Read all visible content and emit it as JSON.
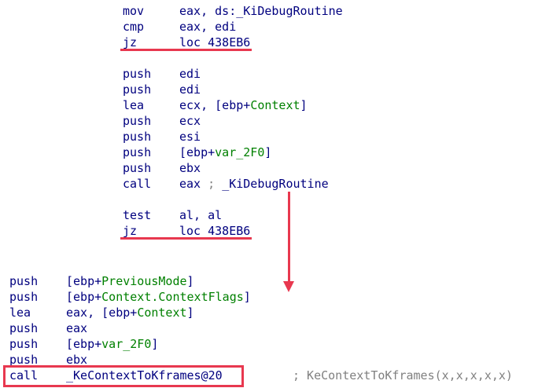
{
  "block1": [
    {
      "mnemonic": "mov",
      "op_parts": [
        {
          "t": "eax, ds:",
          "c": "dl"
        },
        {
          "t": "_KiDebugRoutine",
          "c": "dl"
        }
      ]
    },
    {
      "mnemonic": "cmp",
      "op_parts": [
        {
          "t": "eax, edi",
          "c": "dl"
        }
      ]
    },
    {
      "mnemonic": "jz",
      "op_parts": [
        {
          "t": "loc_438EB6",
          "c": "dl"
        }
      ]
    },
    {
      "mnemonic": "",
      "op_parts": []
    },
    {
      "mnemonic": "push",
      "op_parts": [
        {
          "t": "edi",
          "c": "dl"
        }
      ]
    },
    {
      "mnemonic": "push",
      "op_parts": [
        {
          "t": "edi",
          "c": "dl"
        }
      ]
    },
    {
      "mnemonic": "lea",
      "op_parts": [
        {
          "t": "ecx, [ebp+",
          "c": "dl"
        },
        {
          "t": "Context",
          "c": "g"
        },
        {
          "t": "]",
          "c": "dl"
        }
      ]
    },
    {
      "mnemonic": "push",
      "op_parts": [
        {
          "t": "ecx",
          "c": "dl"
        }
      ]
    },
    {
      "mnemonic": "push",
      "op_parts": [
        {
          "t": "esi",
          "c": "dl"
        }
      ]
    },
    {
      "mnemonic": "push",
      "op_parts": [
        {
          "t": "[ebp+",
          "c": "dl"
        },
        {
          "t": "var_2F0",
          "c": "g"
        },
        {
          "t": "]",
          "c": "dl"
        }
      ]
    },
    {
      "mnemonic": "push",
      "op_parts": [
        {
          "t": "ebx",
          "c": "dl"
        }
      ]
    },
    {
      "mnemonic": "call",
      "op_parts": [
        {
          "t": "eax",
          "c": "dl"
        },
        {
          "t": " ; ",
          "c": "gr"
        },
        {
          "t": "_KiDebugRoutine",
          "c": "dl"
        }
      ]
    },
    {
      "mnemonic": "",
      "op_parts": []
    },
    {
      "mnemonic": "test",
      "op_parts": [
        {
          "t": "al, al",
          "c": "dl"
        }
      ]
    },
    {
      "mnemonic": "jz",
      "op_parts": [
        {
          "t": "loc_438EB6",
          "c": "dl"
        }
      ]
    }
  ],
  "block2": [
    {
      "mnemonic": "push",
      "op_parts": [
        {
          "t": "[ebp+",
          "c": "dl"
        },
        {
          "t": "PreviousMode",
          "c": "g"
        },
        {
          "t": "]",
          "c": "dl"
        }
      ]
    },
    {
      "mnemonic": "push",
      "op_parts": [
        {
          "t": "[ebp+",
          "c": "dl"
        },
        {
          "t": "Context.ContextFlags",
          "c": "g"
        },
        {
          "t": "]",
          "c": "dl"
        }
      ]
    },
    {
      "mnemonic": "lea",
      "op_parts": [
        {
          "t": "eax, [ebp+",
          "c": "dl"
        },
        {
          "t": "Context",
          "c": "g"
        },
        {
          "t": "]",
          "c": "dl"
        }
      ]
    },
    {
      "mnemonic": "push",
      "op_parts": [
        {
          "t": "eax",
          "c": "dl"
        }
      ]
    },
    {
      "mnemonic": "push",
      "op_parts": [
        {
          "t": "[ebp+",
          "c": "dl"
        },
        {
          "t": "var_2F0",
          "c": "g"
        },
        {
          "t": "]",
          "c": "dl"
        }
      ]
    },
    {
      "mnemonic": "push",
      "op_parts": [
        {
          "t": "ebx",
          "c": "dl"
        }
      ]
    },
    {
      "mnemonic": "call",
      "op_parts": [
        {
          "t": "_KeContextToKframes@20",
          "c": "dl"
        }
      ]
    }
  ],
  "call_comment": "; KeContextToKframes(x,x,x,x,x)",
  "colors": {
    "highlight": "#e8384f",
    "text": "#00007f",
    "symbol": "#008000",
    "comment": "#808080"
  }
}
